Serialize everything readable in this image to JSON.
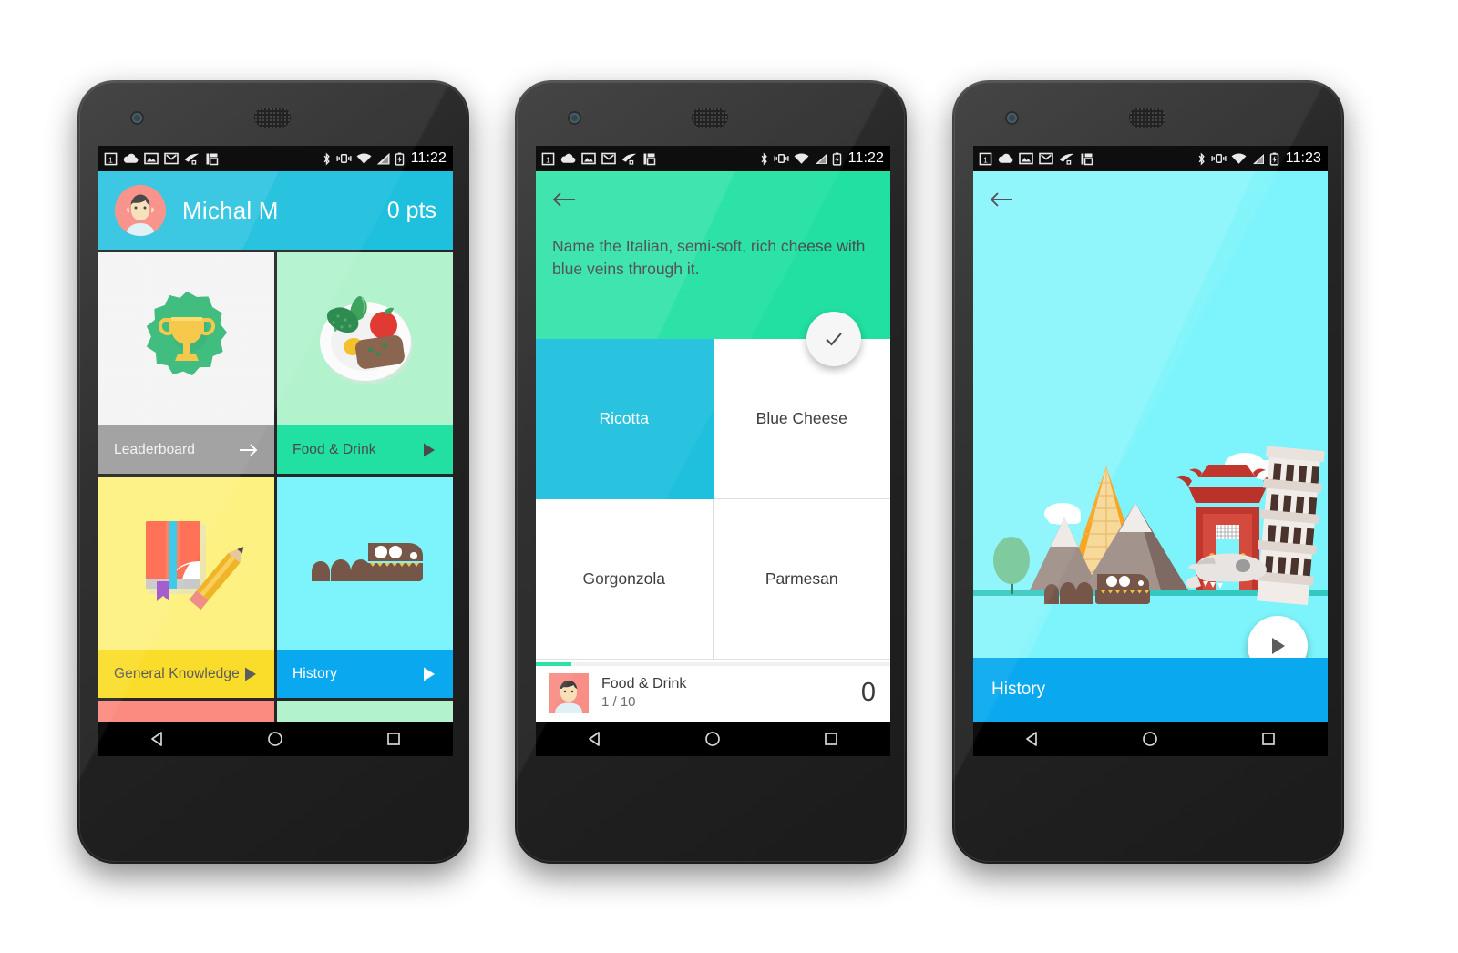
{
  "status_bar": {
    "icons_left": [
      "calendar-icon",
      "cloud-upload-icon",
      "photo-icon",
      "gmail-icon",
      "feed-icon",
      "layers-icon"
    ],
    "icons_right": [
      "bluetooth-icon",
      "vibrate-icon",
      "wifi-icon",
      "signal-icon",
      "battery-charging-icon"
    ],
    "time_1": "11:22",
    "time_2": "11:22",
    "time_3": "11:23"
  },
  "nav_bar": {
    "back": "back-triangle-icon",
    "home": "home-circle-icon",
    "recents": "recents-square-icon"
  },
  "screen_home": {
    "profile": {
      "name": "Michal M",
      "points": "0 pts",
      "avatar": "user-avatar",
      "bg_color": "#1ec0dd"
    },
    "tiles": [
      {
        "name": "Leaderboard",
        "label": "Leaderboard",
        "art": "trophy-badge-icon",
        "art_bg": "#f4f4f4",
        "bar_bg": "#9e9e9e",
        "text_color": "#f2f2f2",
        "action": "arrow-right-icon",
        "action_color": "#ffffff"
      },
      {
        "name": "Food & Drink",
        "label": "Food & Drink",
        "art": "plate-of-food-icon",
        "art_bg": "#b2f2cd",
        "bar_bg": "#21e0a2",
        "text_color": "#4a4a4a",
        "action": "play-triangle-icon",
        "action_color": "#4a4a4a"
      },
      {
        "name": "General Knowledge",
        "label": "General Knowledge",
        "art": "book-and-pencil-icon",
        "art_bg": "#fcf181",
        "bar_bg": "#f9dd2a",
        "text_color": "#5d5d5d",
        "action": "play-triangle-icon",
        "action_color": "#5d5d5d"
      },
      {
        "name": "History",
        "label": "History",
        "art": "dinosaur-train-icon",
        "art_bg": "#7df4fb",
        "bar_bg": "#0aa9ef",
        "text_color": "#ffffff",
        "action": "play-triangle-icon",
        "action_color": "#ffffff"
      }
    ],
    "tiles_partial": [
      {
        "name": "tile-partial-left",
        "bar_bg": "#fb8b80"
      },
      {
        "name": "tile-partial-right",
        "bar_bg": "#b2f2cd"
      }
    ]
  },
  "screen_question": {
    "back_icon": "arrow-left-icon",
    "header_bg": "#21e0a2",
    "question": "Name the Italian, semi-soft, rich cheese with blue veins through it.",
    "confirm_icon": "check-icon",
    "answers": [
      {
        "label": "Ricotta",
        "selected": true
      },
      {
        "label": "Blue Cheese",
        "selected": false
      },
      {
        "label": "Gorgonzola",
        "selected": false
      },
      {
        "label": "Parmesan",
        "selected": false
      }
    ],
    "footer": {
      "avatar": "user-avatar",
      "category": "Food & Drink",
      "counter": "1 / 10",
      "score": "0",
      "progress_percent": 10,
      "progress_color": "#21e0a2"
    }
  },
  "screen_category": {
    "back_icon": "arrow-left-icon",
    "bg_color": "#7df4fb",
    "illustration": "history-landmarks-illustration",
    "footer_label": "History",
    "footer_bg": "#0aa9ef",
    "play_icon": "play-triangle-icon"
  }
}
